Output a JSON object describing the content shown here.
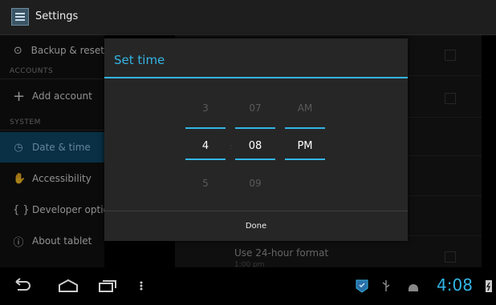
{
  "app": {
    "title": "Settings"
  },
  "sidebar": {
    "items": [
      {
        "label": "Backup & reset",
        "icon": "backup-icon"
      },
      {
        "label": "Add account",
        "icon": "plus-icon"
      },
      {
        "label": "Date & time",
        "icon": "clock-icon",
        "selected": true
      },
      {
        "label": "Accessibility",
        "icon": "hand-icon"
      },
      {
        "label": "Developer options",
        "icon": "braces-icon"
      },
      {
        "label": "About tablet",
        "icon": "info-icon"
      }
    ],
    "headers": [
      "ACCOUNTS",
      "SYSTEM"
    ]
  },
  "content": {
    "use24_title": "Use 24-hour format",
    "use24_sub": "1:00 pm"
  },
  "dialog": {
    "title": "Set time",
    "hour": {
      "prev": "3",
      "current": "4",
      "next": "5"
    },
    "minute": {
      "prev": "07",
      "current": "08",
      "next": "09"
    },
    "ampm": {
      "prev": "AM",
      "current": "PM"
    },
    "done_label": "Done"
  },
  "statusbar": {
    "time": "4:08"
  },
  "colors": {
    "accent": "#33b5e5",
    "selected_bg": "#0e4a6a"
  }
}
